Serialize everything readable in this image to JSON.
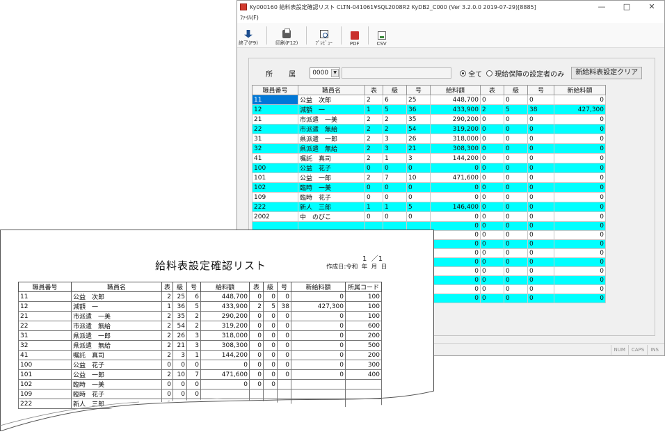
{
  "window": {
    "title": "Ky000160 給料表設定確認リスト CLTN-041061¥SQL2008R2 KyDB2_C000 (Ver 3.2.0.0 2019-07-29)[8885]",
    "minimize": "—",
    "maximize": "□",
    "close": "✕"
  },
  "menu": {
    "file": "ﾌｧｲﾙ(F)"
  },
  "toolbar": {
    "exit": "終了(F9)",
    "print": "印刷(F12)",
    "preview": "ﾌﾟﾚﾋﾞｭｰ",
    "pdf": "PDF",
    "csv": "CSV"
  },
  "filter": {
    "dept_label": "所 属",
    "dept_code": "0000",
    "dropdown_glyph": "▼",
    "radio_all": "全て",
    "radio_guarantee": "現給保障の設定者のみ",
    "clear_button": "新給料表設定クリア"
  },
  "grid": {
    "columns": [
      "職員番号",
      "職員名",
      "表",
      "級",
      "号",
      "給料額",
      "表",
      "級",
      "号",
      "新給料額"
    ],
    "rows": [
      [
        "11",
        "公益　次郎",
        "2",
        "6",
        "25",
        "448,700",
        "0",
        "0",
        "0",
        "0"
      ],
      [
        "12",
        "減額　一",
        "1",
        "5",
        "36",
        "433,900",
        "2",
        "5",
        "38",
        "427,300"
      ],
      [
        "21",
        "市派遣　一美",
        "2",
        "2",
        "35",
        "290,200",
        "0",
        "0",
        "0",
        "0"
      ],
      [
        "22",
        "市派遣　無給",
        "2",
        "2",
        "54",
        "319,200",
        "0",
        "0",
        "0",
        "0"
      ],
      [
        "31",
        "県派遣　一郎",
        "2",
        "3",
        "26",
        "318,000",
        "0",
        "0",
        "0",
        "0"
      ],
      [
        "32",
        "県派遣　無給",
        "2",
        "3",
        "21",
        "308,300",
        "0",
        "0",
        "0",
        "0"
      ],
      [
        "41",
        "嘱託　真司",
        "2",
        "1",
        "3",
        "144,200",
        "0",
        "0",
        "0",
        "0"
      ],
      [
        "100",
        "公益　花子",
        "0",
        "0",
        "0",
        "0",
        "0",
        "0",
        "0",
        "0"
      ],
      [
        "101",
        "公益　一郎",
        "2",
        "7",
        "10",
        "471,600",
        "0",
        "0",
        "0",
        "0"
      ],
      [
        "102",
        "臨時　一美",
        "0",
        "0",
        "0",
        "0",
        "0",
        "0",
        "0",
        "0"
      ],
      [
        "109",
        "臨時　花子",
        "0",
        "0",
        "0",
        "0",
        "0",
        "0",
        "0",
        "0"
      ],
      [
        "222",
        "新人　三郎",
        "1",
        "1",
        "5",
        "146,400",
        "0",
        "0",
        "0",
        "0"
      ],
      [
        "2002",
        "中　のびこ",
        "0",
        "0",
        "0",
        "0",
        "0",
        "0",
        "0",
        "0"
      ],
      [
        "",
        "",
        "",
        "",
        "",
        "0",
        "0",
        "0",
        "0",
        "0"
      ],
      [
        "",
        "",
        "",
        "",
        "",
        "0",
        "0",
        "0",
        "0",
        "0"
      ],
      [
        "",
        "",
        "",
        "",
        "",
        "0",
        "0",
        "0",
        "0",
        "0"
      ],
      [
        "",
        "",
        "",
        "",
        "",
        "0",
        "0",
        "0",
        "0",
        "0"
      ],
      [
        "",
        "",
        "",
        "",
        "",
        "0",
        "0",
        "0",
        "0",
        "0"
      ],
      [
        "",
        "",
        "",
        "",
        "",
        "0",
        "0",
        "0",
        "0",
        "0"
      ],
      [
        "",
        "",
        "",
        "",
        "",
        "0",
        "0",
        "0",
        "0",
        "0"
      ],
      [
        "",
        "",
        "",
        "",
        "",
        "0",
        "0",
        "0",
        "0",
        "0"
      ],
      [
        "",
        "",
        "",
        "",
        "",
        "0",
        "0",
        "0",
        "0",
        "0"
      ]
    ]
  },
  "status": {
    "num": "NUM",
    "caps": "CAPS",
    "ins": "INS"
  },
  "report": {
    "title": "給料表設定確認リスト",
    "page": "1  ／1",
    "created": "作成日:令和  年  月  日",
    "columns": [
      "職員番号",
      "職員名",
      "表",
      "級",
      "号",
      "給料額",
      "表",
      "級",
      "号",
      "新給料額",
      "所属コード"
    ],
    "rows": [
      [
        "11",
        "公益　次郎",
        "2",
        "25",
        "6",
        "448,700",
        "0",
        "0",
        "0",
        "0",
        "100"
      ],
      [
        "12",
        "減額　一",
        "1",
        "36",
        "5",
        "433,900",
        "2",
        "5",
        "38",
        "427,300",
        "100"
      ],
      [
        "21",
        "市派遣　一美",
        "2",
        "35",
        "2",
        "290,200",
        "0",
        "0",
        "0",
        "0",
        "100"
      ],
      [
        "22",
        "市派遣　無給",
        "2",
        "54",
        "2",
        "319,200",
        "0",
        "0",
        "0",
        "0",
        "600"
      ],
      [
        "31",
        "県派遣　一郎",
        "2",
        "26",
        "3",
        "318,000",
        "0",
        "0",
        "0",
        "0",
        "200"
      ],
      [
        "32",
        "県派遣　無給",
        "2",
        "21",
        "3",
        "308,300",
        "0",
        "0",
        "0",
        "0",
        "500"
      ],
      [
        "41",
        "嘱託　真司",
        "2",
        "3",
        "1",
        "144,200",
        "0",
        "0",
        "0",
        "0",
        "200"
      ],
      [
        "100",
        "公益　花子",
        "0",
        "0",
        "0",
        "0",
        "0",
        "0",
        "0",
        "0",
        "300"
      ],
      [
        "101",
        "公益　一郎",
        "2",
        "10",
        "7",
        "471,600",
        "0",
        "0",
        "0",
        "0",
        "400"
      ],
      [
        "102",
        "臨時　一美",
        "0",
        "0",
        "0",
        "0",
        "0",
        "0",
        "",
        "",
        ""
      ],
      [
        "109",
        "臨時　花子",
        "0",
        "0",
        "0",
        "",
        "",
        "",
        "",
        "",
        ""
      ],
      [
        "222",
        "新人　三郎",
        "1",
        "5",
        "",
        "",
        "",
        "",
        "",
        "",
        ""
      ]
    ]
  },
  "colors": {
    "row_highlight": "#00ffff",
    "selection": "#0078d7"
  }
}
